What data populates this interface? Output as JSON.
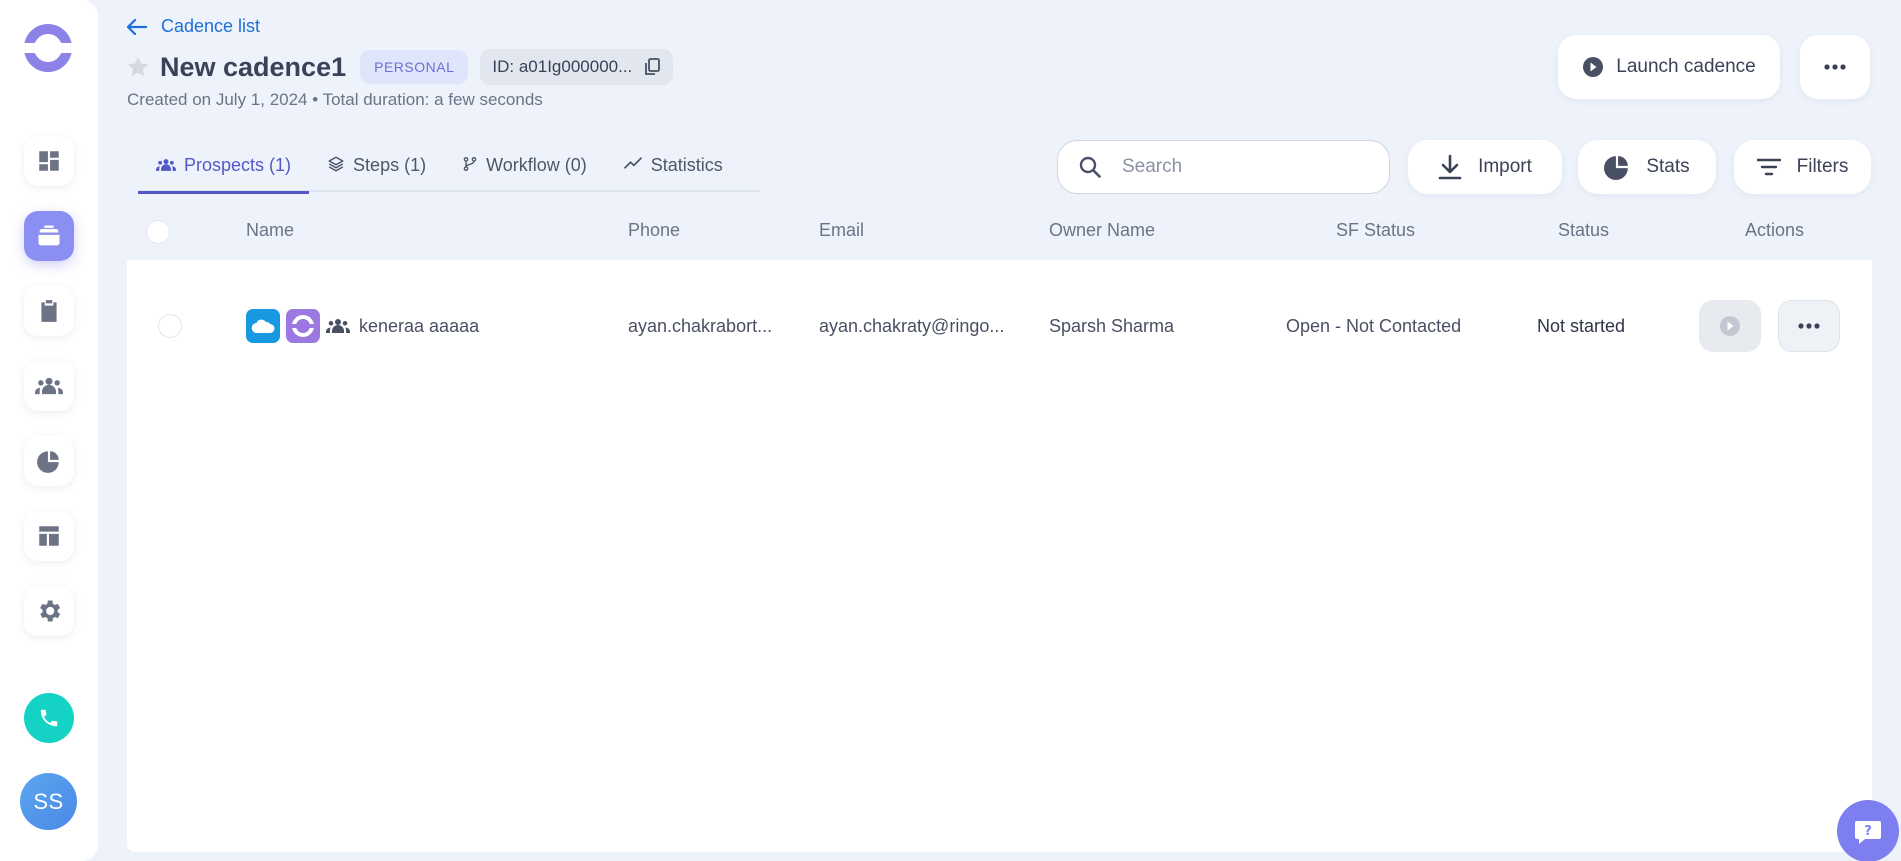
{
  "colors": {
    "accent": "#5358c9",
    "link": "#1e6fd9",
    "sidebar_active": "#8c8ff2",
    "phone": "#14d3c5",
    "salesforce": "#1798e0",
    "background": "#eef3fb"
  },
  "sidebar": {
    "items": [
      {
        "icon": "dashboard-icon",
        "active": false
      },
      {
        "icon": "cadences-icon",
        "active": true
      },
      {
        "icon": "tasks-clipboard-icon",
        "active": false
      },
      {
        "icon": "people-icon",
        "active": false
      },
      {
        "icon": "pie-chart-icon",
        "active": false
      },
      {
        "icon": "templates-layout-icon",
        "active": false
      },
      {
        "icon": "settings-gear-icon",
        "active": false
      }
    ],
    "avatar_initials": "SS"
  },
  "header": {
    "back_label": "Cadence list",
    "title": "New cadence1",
    "badge": "PERSONAL",
    "id_prefix": "ID:",
    "id_value": "a01Ig000000...",
    "meta": "Created on July 1, 2024 • Total duration: a few seconds",
    "launch_label": "Launch cadence"
  },
  "tabs": [
    {
      "label": "Prospects (1)",
      "icon": "people-icon",
      "active": true
    },
    {
      "label": "Steps (1)",
      "icon": "layers-icon",
      "active": false
    },
    {
      "label": "Workflow (0)",
      "icon": "branch-icon",
      "active": false
    },
    {
      "label": "Statistics",
      "icon": "trend-icon",
      "active": false
    }
  ],
  "toolbar": {
    "search_placeholder": "Search",
    "import_label": "Import",
    "stats_label": "Stats",
    "filters_label": "Filters"
  },
  "table": {
    "columns": [
      "Name",
      "Phone",
      "Email",
      "Owner Name",
      "SF Status",
      "Status",
      "Actions"
    ],
    "rows": [
      {
        "name": "keneraa aaaaa",
        "phone": "ayan.chakrabort...",
        "email": "ayan.chakraty@ringo...",
        "owner": "Sparsh Sharma",
        "sf_status": "Open - Not Contacted",
        "status": "Not started"
      }
    ]
  }
}
